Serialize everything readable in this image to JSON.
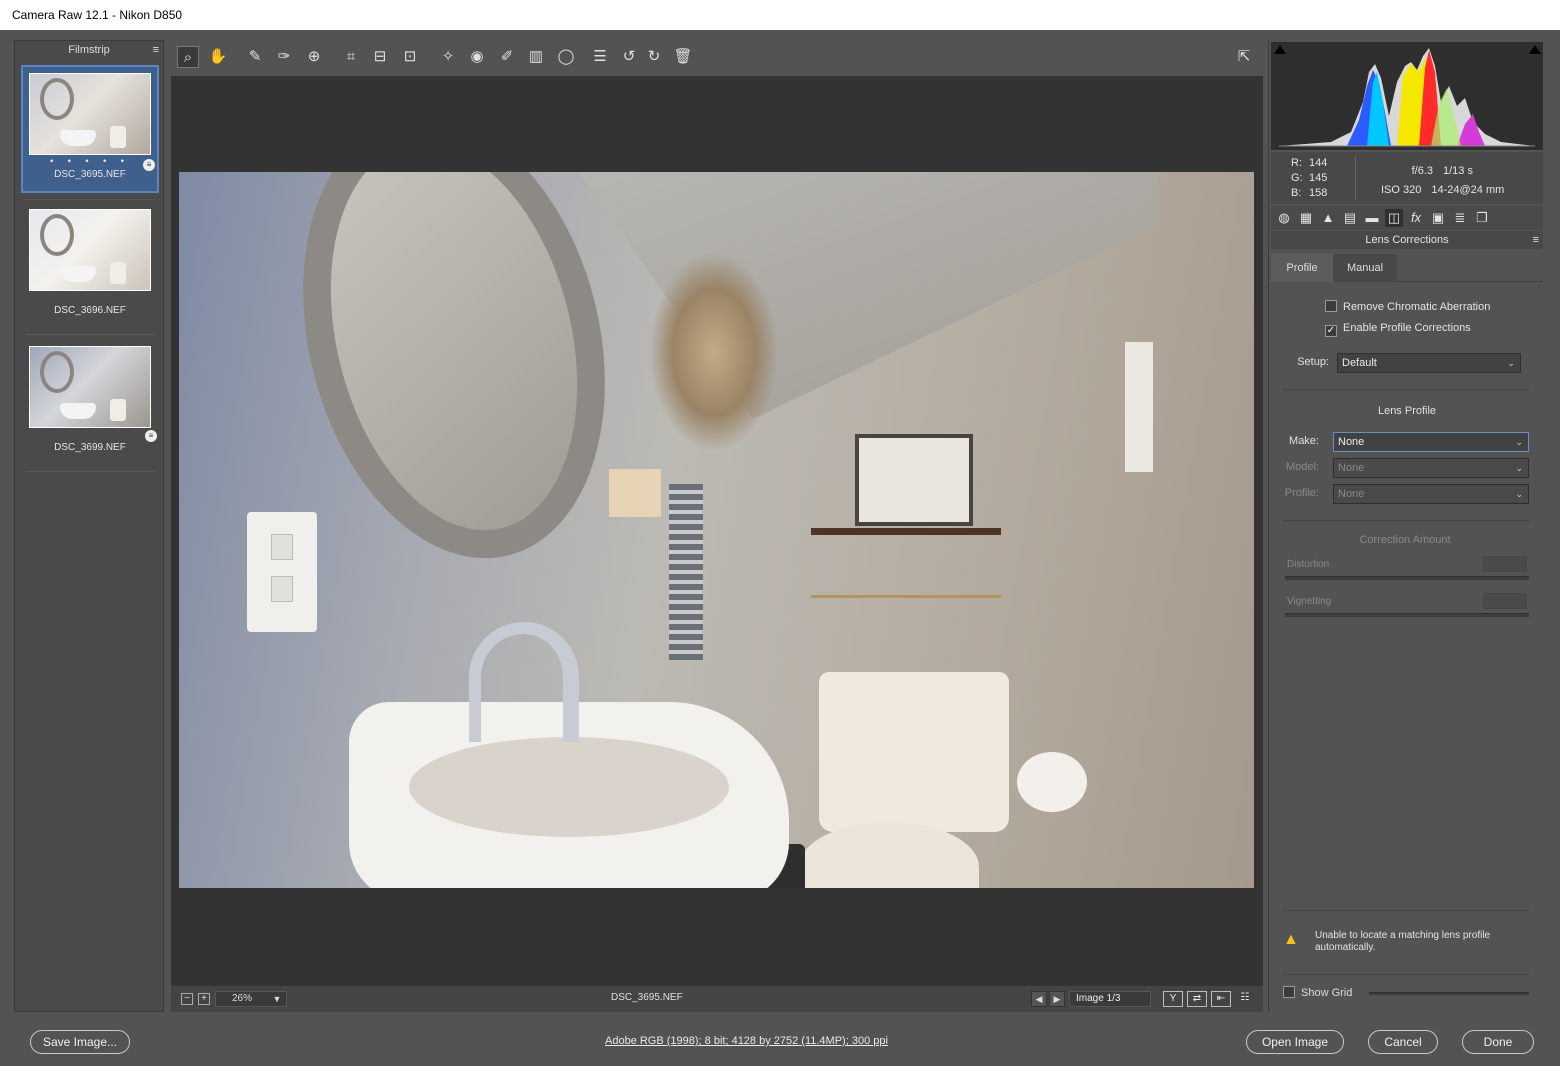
{
  "window": {
    "title": "Camera Raw 12.1  -  Nikon D850"
  },
  "filmstrip": {
    "header": "Filmstrip",
    "menu_icon": "≡",
    "items": [
      {
        "name": "DSC_3695.NEF",
        "rating": "• • • • •",
        "selected": true
      },
      {
        "name": "DSC_3696.NEF",
        "selected": false
      },
      {
        "name": "DSC_3699.NEF",
        "selected": false
      }
    ]
  },
  "toolbar": {
    "tools": [
      "zoom-tool",
      "hand-tool",
      "white-balance-tool",
      "color-sampler-tool",
      "targeted-adjustment-tool",
      "crop-tool",
      "straighten-tool",
      "transform-tool",
      "spot-removal-tool",
      "red-eye-tool",
      "adjustment-brush",
      "graduated-filter",
      "radial-filter",
      "preferences",
      "rotate-ccw",
      "rotate-cw",
      "delete"
    ]
  },
  "status": {
    "zoom_value": "26%",
    "filename": "DSC_3695.NEF",
    "image_counter": "Image 1/3"
  },
  "readout": {
    "r_label": "R:",
    "r_value": "144",
    "g_label": "G:",
    "g_value": "145",
    "b_label": "B:",
    "b_value": "158",
    "aperture": "f/6.3",
    "shutter": "1/13 s",
    "iso": "ISO 320",
    "lens": "14-24@24 mm"
  },
  "panel": {
    "title": "Lens Corrections",
    "tabs": [
      "Profile",
      "Manual"
    ],
    "remove_ca_label": "Remove Chromatic Aberration",
    "remove_ca_checked": false,
    "enable_profile_label": "Enable Profile Corrections",
    "enable_profile_checked": true,
    "setup_label": "Setup:",
    "setup_value": "Default",
    "lens_profile_heading": "Lens Profile",
    "make_label": "Make:",
    "make_value": "None",
    "model_label": "Model:",
    "model_value": "None",
    "profile_label": "Profile:",
    "profile_value": "None",
    "correction_heading": "Correction Amount",
    "distortion_label": "Distortion",
    "vignetting_label": "Vignetting",
    "warning_text": "Unable to locate a matching lens profile automatically.",
    "show_grid_label": "Show Grid",
    "show_grid_checked": false
  },
  "footer": {
    "save_label": "Save Image...",
    "workflow_text": "Adobe RGB (1998); 8 bit; 4128 by 2752 (11.4MP); 300 ppi",
    "open_label": "Open Image",
    "cancel_label": "Cancel",
    "done_label": "Done"
  },
  "histogram": {
    "note_colors": [
      "#2a5cff",
      "#00c8ff",
      "#f5e800",
      "#ff2b2b",
      "#d43bd8",
      "#ffffff"
    ]
  }
}
